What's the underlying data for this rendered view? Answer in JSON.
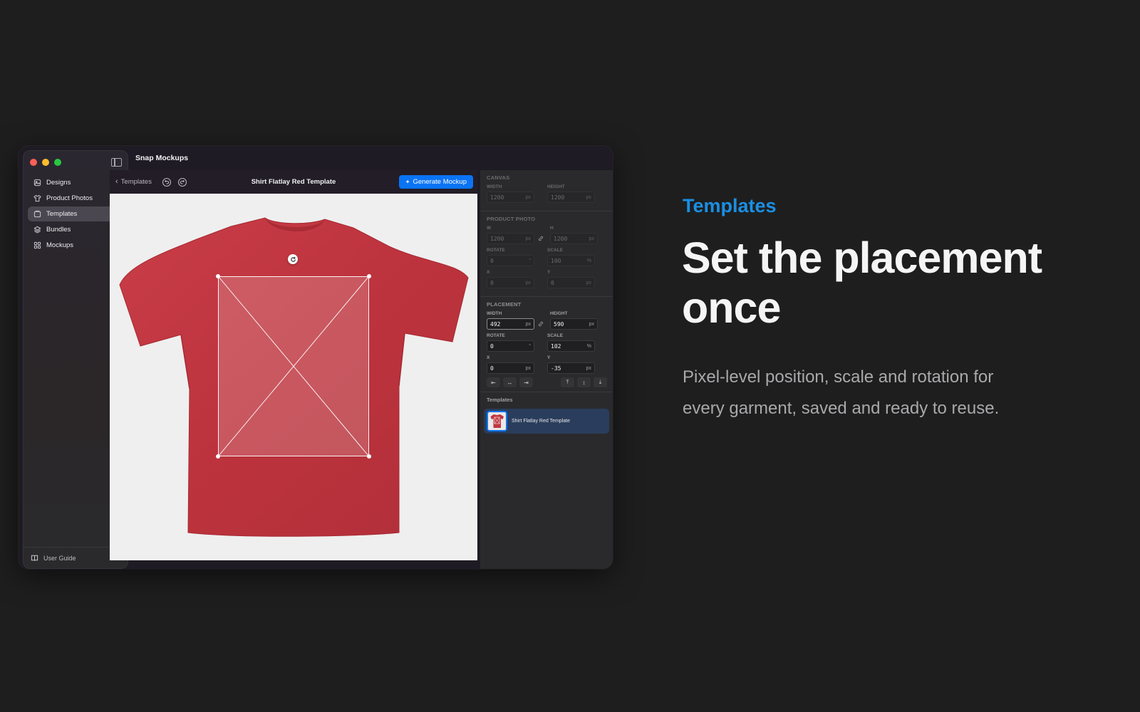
{
  "app": {
    "title": "Snap Mockups",
    "window_controls": [
      "close",
      "minimize",
      "zoom"
    ]
  },
  "sidebar": {
    "items": [
      {
        "label": "Designs",
        "icon": "designs-icon",
        "active": false
      },
      {
        "label": "Product Photos",
        "icon": "shirt-icon",
        "active": false
      },
      {
        "label": "Templates",
        "icon": "template-icon",
        "active": true
      },
      {
        "label": "Bundles",
        "icon": "layers-icon",
        "active": false
      },
      {
        "label": "Mockups",
        "icon": "grid-icon",
        "active": false
      }
    ],
    "footer_label": "User Guide"
  },
  "toolbar": {
    "back_label": "Templates",
    "document_title": "Shirt Flatlay Red Template",
    "generate_label": "Generate Mockup"
  },
  "canvas": {
    "shirt_color": "#c0353f",
    "placement_color": "#ffffff"
  },
  "inspector": {
    "canvas": {
      "title": "CANVAS",
      "width_label": "WIDTH",
      "width_value": "1200",
      "width_unit": "px",
      "height_label": "HEIGHT",
      "height_value": "1200",
      "height_unit": "px"
    },
    "product_photo": {
      "title": "PRODUCT PHOTO",
      "w_label": "W",
      "w_value": "1200",
      "w_unit": "px",
      "h_label": "H",
      "h_value": "1200",
      "h_unit": "px",
      "rotate_label": "ROTATE",
      "rotate_value": "0",
      "rotate_unit": "°",
      "scale_label": "SCALE",
      "scale_value": "100",
      "scale_unit": "%",
      "x_label": "X",
      "x_value": "0",
      "x_unit": "px",
      "y_label": "Y",
      "y_value": "0",
      "y_unit": "px"
    },
    "placement": {
      "title": "PLACEMENT",
      "width_label": "WIDTH",
      "width_value": "492",
      "width_unit": "px",
      "height_label": "HEIGHT",
      "height_value": "590",
      "height_unit": "px",
      "rotate_label": "ROTATE",
      "rotate_value": "0",
      "rotate_unit": "°",
      "scale_label": "SCALE",
      "scale_value": "102",
      "scale_unit": "%",
      "x_label": "X",
      "x_value": "0",
      "x_unit": "px",
      "y_label": "Y",
      "y_value": "-35",
      "y_unit": "px"
    },
    "templates": {
      "title": "Templates",
      "items": [
        {
          "name": "Shirt Flatlay Red Template",
          "selected": true
        }
      ]
    }
  },
  "marketing": {
    "eyebrow": "Templates",
    "headline_line1": "Set the placement",
    "headline_line2": "once",
    "body_line1": "Pixel-level position, scale and rotation for",
    "body_line2": "every garment, saved and ready to reuse.",
    "accent_color": "#1a8fe3"
  }
}
